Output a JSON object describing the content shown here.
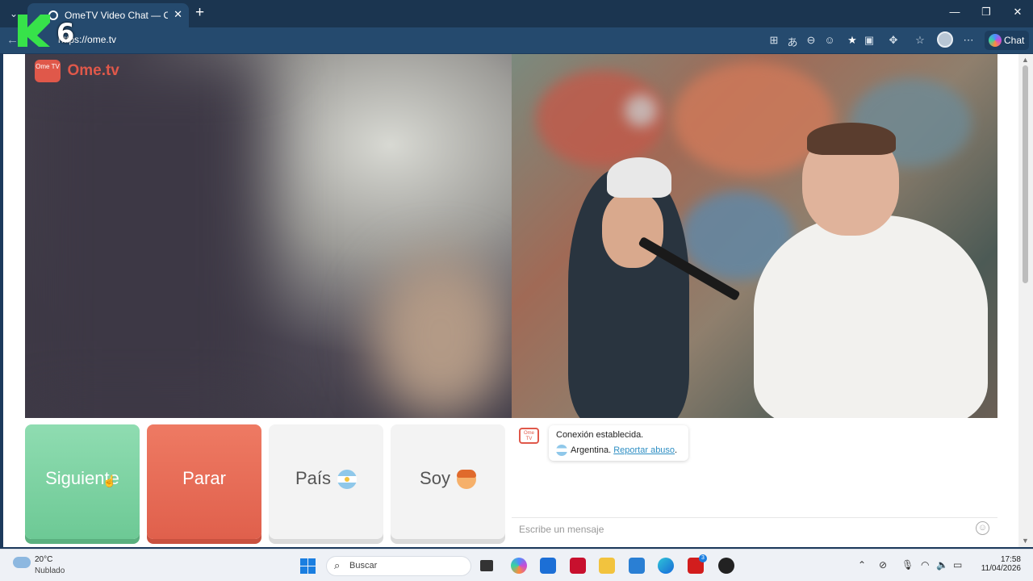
{
  "browser": {
    "tab_title": "OmeTV Video Chat — Omegl",
    "url": "https://ome.tv",
    "chat_button_label": "Chat",
    "icons": [
      "tab-menu-icon",
      "new-tab-icon",
      "minimize-icon",
      "maximize-icon",
      "close-icon",
      "back-icon",
      "apps-icon",
      "translate-icon",
      "zoom-out-icon",
      "reading-icon",
      "favorite-star-icon",
      "camera-icon",
      "extensions-icon",
      "favorites-icon",
      "profile-avatar",
      "more-icon",
      "copilot-icon"
    ]
  },
  "overlay": {
    "channel_number": "6"
  },
  "site": {
    "logo_tv_text": "Ome TV",
    "logo_name": "Ome.tv",
    "buttons": {
      "next": "Siguiente",
      "stop": "Parar",
      "country": "País",
      "gender": "Soy"
    },
    "colors": {
      "next": "#6dc995",
      "stop": "#e0604c",
      "brand": "#e0584a"
    }
  },
  "chat": {
    "status_message": "Conexión establecida.",
    "country_name": "Argentina.",
    "report_link": "Reportar abuso",
    "report_suffix": ".",
    "input_placeholder": "Escribe un mensaje"
  },
  "taskbar": {
    "weather_temp": "20°C",
    "weather_desc": "Nublado",
    "search_placeholder": "Buscar",
    "time": "17:58",
    "date": "11/04/2026",
    "badge_count": "3"
  }
}
